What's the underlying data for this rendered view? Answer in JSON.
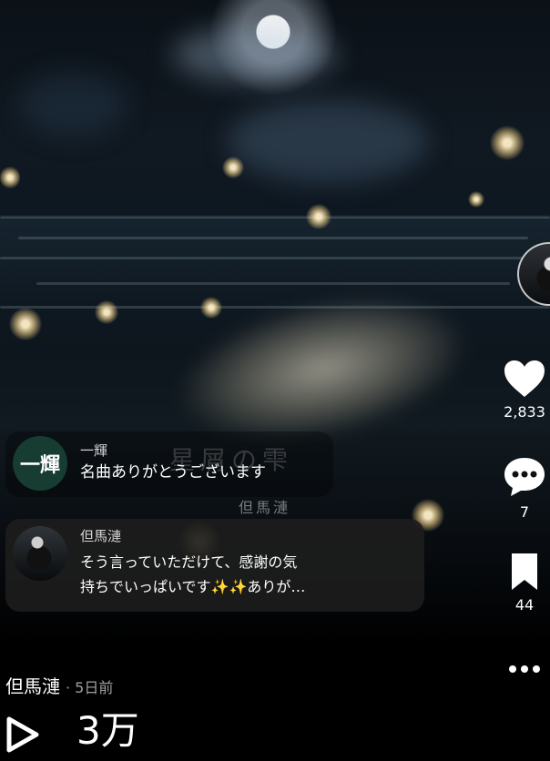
{
  "overlay": {
    "title_watermark": "星屑の雫",
    "artist_watermark": "但馬漣"
  },
  "right_rail": {
    "likes": "2,833",
    "comments": "7",
    "saves": "44"
  },
  "comments": [
    {
      "avatar_text": "一輝",
      "name": "一輝",
      "text": "名曲ありがとうございます"
    },
    {
      "avatar_text": "",
      "name": "但馬漣",
      "text": "そう言っていただけて、感謝の気\n持ちでいっぱいです✨✨ありが…"
    }
  ],
  "footer": {
    "username": "但馬漣",
    "time": "· 5日前",
    "play_count": "3万"
  },
  "icons": {
    "heart": "heart-icon",
    "comment": "comment-bubble-icon",
    "bookmark": "bookmark-icon",
    "more": "more-dots-icon",
    "play": "play-icon"
  }
}
